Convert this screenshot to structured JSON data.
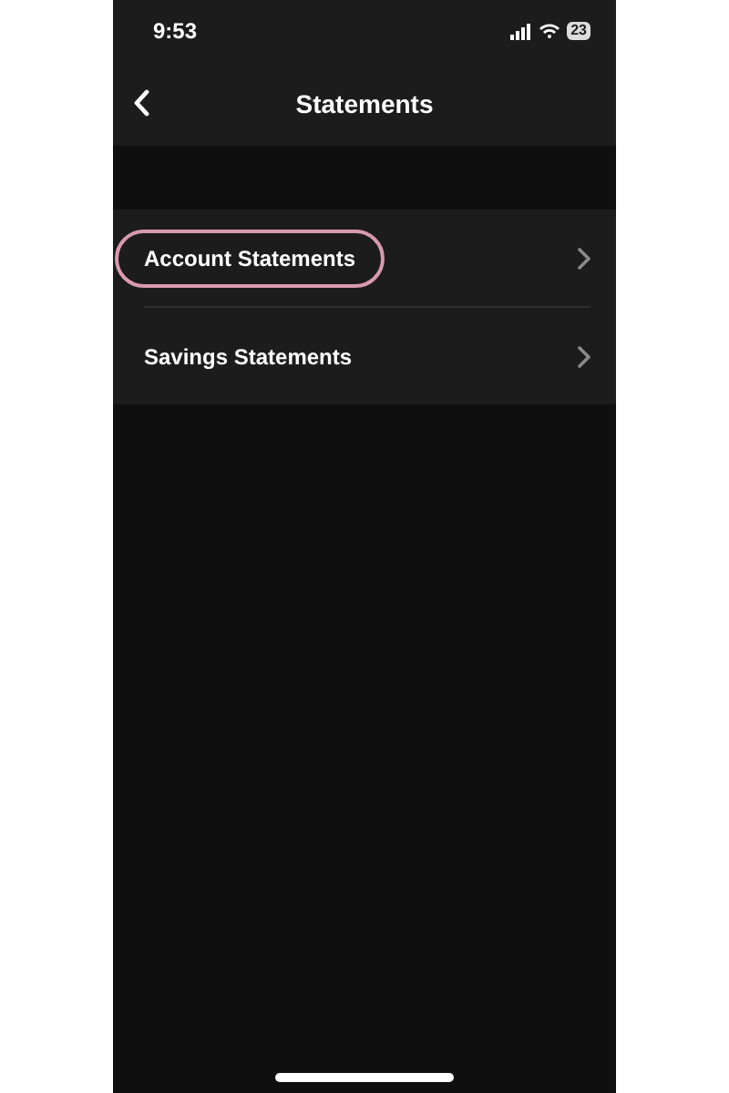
{
  "status_bar": {
    "time": "9:53",
    "battery": "23"
  },
  "header": {
    "title": "Statements"
  },
  "items": [
    {
      "label": "Account Statements",
      "highlighted": true
    },
    {
      "label": "Savings Statements",
      "highlighted": false
    }
  ]
}
